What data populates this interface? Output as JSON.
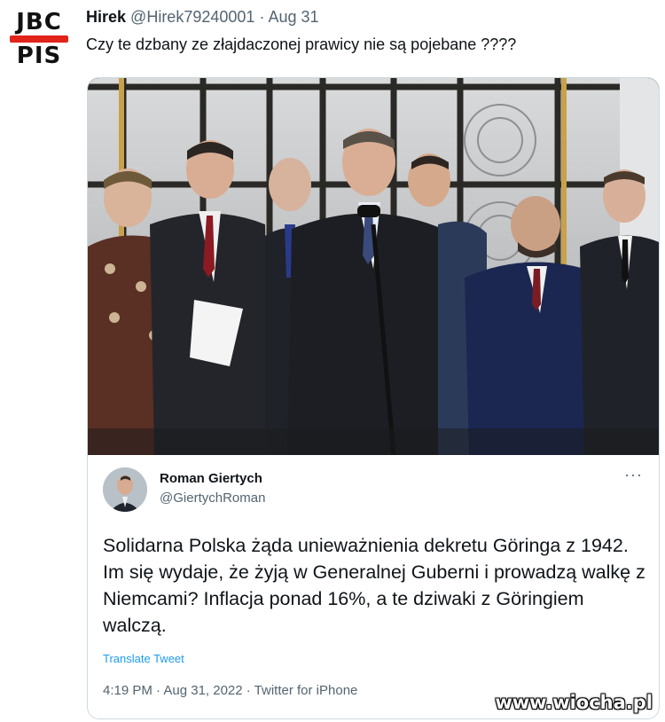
{
  "author": {
    "avatar_text_top": "JBC",
    "avatar_text_bottom": "PIS",
    "display_name": "Hirek",
    "handle": "@Hirek79240001",
    "separator": "·",
    "date": "Aug 31"
  },
  "tweet": {
    "text": "Czy te dzbany ze złajdaczonej prawicy nie są pojebane ????"
  },
  "photo": {
    "description_icon": "press-conference-photo"
  },
  "quoted_tweet": {
    "display_name": "Roman Giertych",
    "handle": "@GiertychRoman",
    "more_icon": "···",
    "lines": [
      "Solidarna Polska żąda unieważnienia dekretu Göringa z 1942.",
      "Im się wydaje, że żyją w Generalnej Guberni i prowadzą walkę z Niemcami? Inflacja ponad 16%, a te dziwaki z Göringiem walczą."
    ],
    "translate_label": "Translate Tweet",
    "meta": "4:19 PM · Aug 31, 2022 · Twitter for iPhone"
  },
  "watermark": "www.wiocha.pl",
  "colors": {
    "link": "#1d9bf0",
    "secondary_text": "#536471",
    "avatar_bar": "#e2231a"
  }
}
